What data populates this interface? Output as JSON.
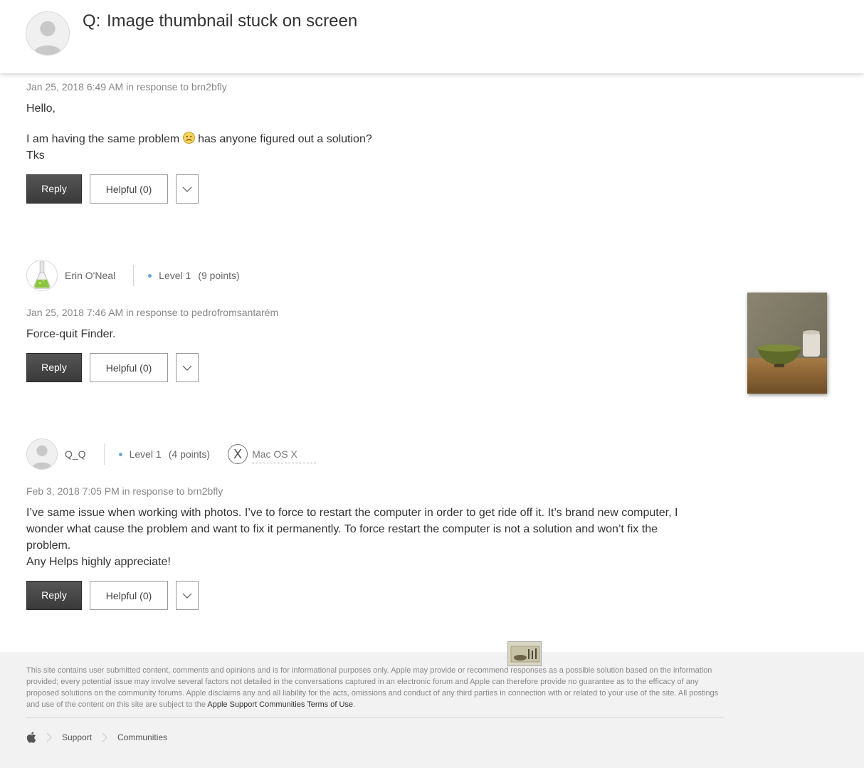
{
  "question": {
    "label": "Q:",
    "title": "Image thumbnail stuck on screen"
  },
  "posts": [
    {
      "meta": "Jan 25, 2018 6:49 AM in response to brn2bfly",
      "lines": [
        "Hello,",
        "I am having the same problem",
        "has anyone figured out a solution?",
        "Tks"
      ],
      "reply_label": "Reply",
      "helpful_label": "Helpful (0)"
    },
    {
      "author": "Erin O'Neal",
      "level": "Level 1",
      "points": "(9 points)",
      "meta": "Jan 25, 2018 7:46 AM in response to pedrofromsantarém",
      "lines": [
        "Force-quit Finder."
      ],
      "reply_label": "Reply",
      "helpful_label": "Helpful (0)"
    },
    {
      "author": "Q_Q",
      "level": "Level 1",
      "points": "(4 points)",
      "os_icon": "X",
      "os_label": "Mac OS X",
      "meta": "Feb 3, 2018 7:05 PM in response to brn2bfly",
      "lines": [
        "I’ve same issue when working with photos. I’ve to force to restart the computer in order to get ride off it. It’s brand new computer, I",
        "wonder what cause the problem and want to fix it  permanently. To force restart the computer is not a solution and won’t fix the",
        "problem.",
        "Any Helps highly appreciate!"
      ],
      "reply_label": "Reply",
      "helpful_label": "Helpful (0)"
    }
  ],
  "footer": {
    "disclaimer": "This site contains user submitted content, comments and opinions and is for informational purposes only. Apple may provide or recommend responses as a possible solution based on the information provided; every potential issue may involve several factors not detailed in the conversations captured in an electronic forum and Apple can therefore provide no guarantee as to the efficacy of any proposed solutions on the community forums. Apple disclaims any and all liability for the acts, omissions and conduct of any third parties in connection with or related to your use of the site. All postings and use of the content on this site are subject to the",
    "terms_link": "Apple Support Communities Terms of Use",
    "terms_end": ".",
    "breadcrumb": [
      "Support",
      "Communities"
    ]
  },
  "icons": {
    "apple": "apple-logo-icon",
    "sad": "sad-face-icon",
    "chevron": "chevron-down-icon",
    "breadcrumb_sep": "chevron-right-icon"
  },
  "colors": {
    "reply_button": "#444444",
    "level_dot": "#6aa6e0",
    "footer_bg": "#f2f2f2"
  }
}
